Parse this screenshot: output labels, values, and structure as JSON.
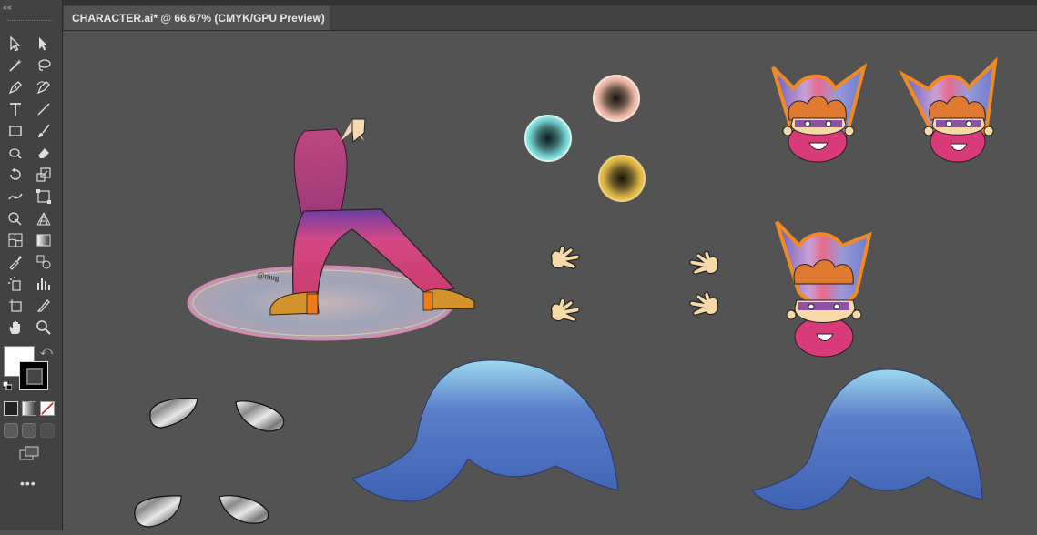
{
  "document_tab": {
    "title": "CHARACTER.ai* @ 66.67% (CMYK/GPU Preview)",
    "close_glyph": "×"
  },
  "toolbar": {
    "collapse_glyph": "««",
    "more_glyph": "•••",
    "tools": [
      "selection-tool",
      "direct-selection-tool",
      "magic-wand-tool",
      "lasso-tool",
      "pen-tool",
      "curvature-tool",
      "type-tool",
      "line-segment-tool",
      "rectangle-tool",
      "paintbrush-tool",
      "shaper-tool",
      "eraser-tool",
      "rotate-tool",
      "scale-tool",
      "width-tool",
      "free-transform-tool",
      "shape-builder-tool",
      "perspective-grid-tool",
      "mesh-tool",
      "gradient-tool",
      "eyedropper-tool",
      "blend-tool",
      "symbol-sprayer-tool",
      "column-graph-tool",
      "artboard-tool",
      "slice-tool",
      "hand-tool",
      "zoom-tool"
    ],
    "fill_color": "#ffffff",
    "stroke_color": "#000000"
  },
  "artwork": {
    "signature_text": "@mug"
  },
  "colors": {
    "canvas": "#535353",
    "panel": "#424242",
    "shoe": "#d4922a",
    "body_pink": "#d04a86",
    "wave_blue": "#4a6fc0",
    "flame_orange": "#f08a24"
  }
}
